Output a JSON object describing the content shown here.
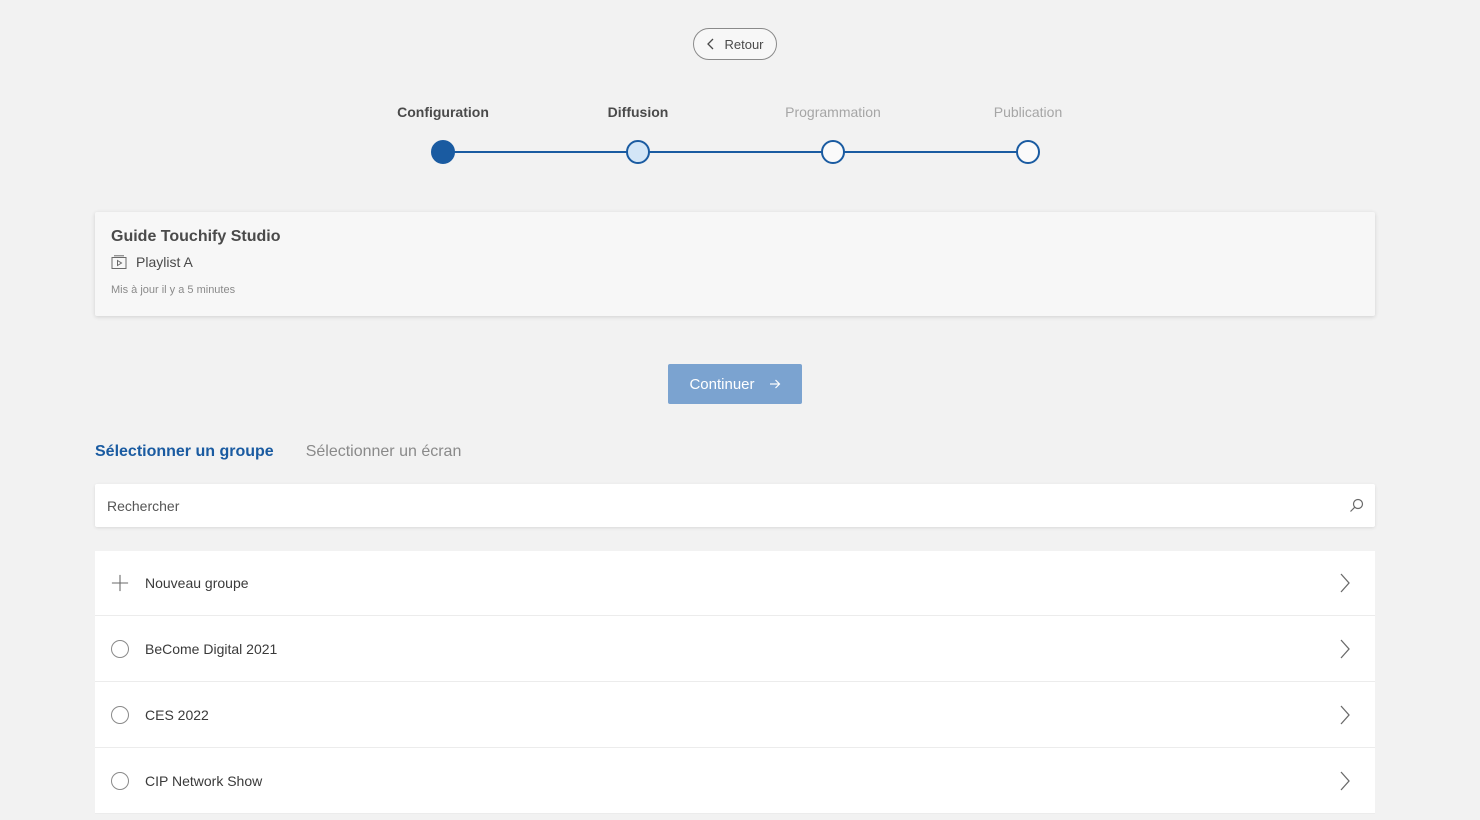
{
  "back": {
    "label": "Retour"
  },
  "stepper": {
    "steps": [
      {
        "label": "Configuration",
        "state": "completed"
      },
      {
        "label": "Diffusion",
        "state": "current"
      },
      {
        "label": "Programmation",
        "state": "pending"
      },
      {
        "label": "Publication",
        "state": "pending"
      }
    ],
    "accent_color": "#1a5ba1"
  },
  "summary": {
    "title": "Guide Touchify Studio",
    "playlist": "Playlist A",
    "playlist_icon": "playlist-icon",
    "updated": "Mis à jour il y a 5 minutes"
  },
  "continue": {
    "label": "Continuer",
    "icon": "arrow-right-icon",
    "color": "#7ba3d0"
  },
  "tabs": [
    {
      "label": "Sélectionner un groupe",
      "active": true
    },
    {
      "label": "Sélectionner un écran",
      "active": false
    }
  ],
  "search": {
    "placeholder": "Rechercher",
    "value": "",
    "icon": "search-icon"
  },
  "groups": {
    "new_group_label": "Nouveau groupe",
    "items": [
      {
        "label": "BeCome Digital 2021"
      },
      {
        "label": "CES 2022"
      },
      {
        "label": "CIP Network Show"
      }
    ]
  }
}
